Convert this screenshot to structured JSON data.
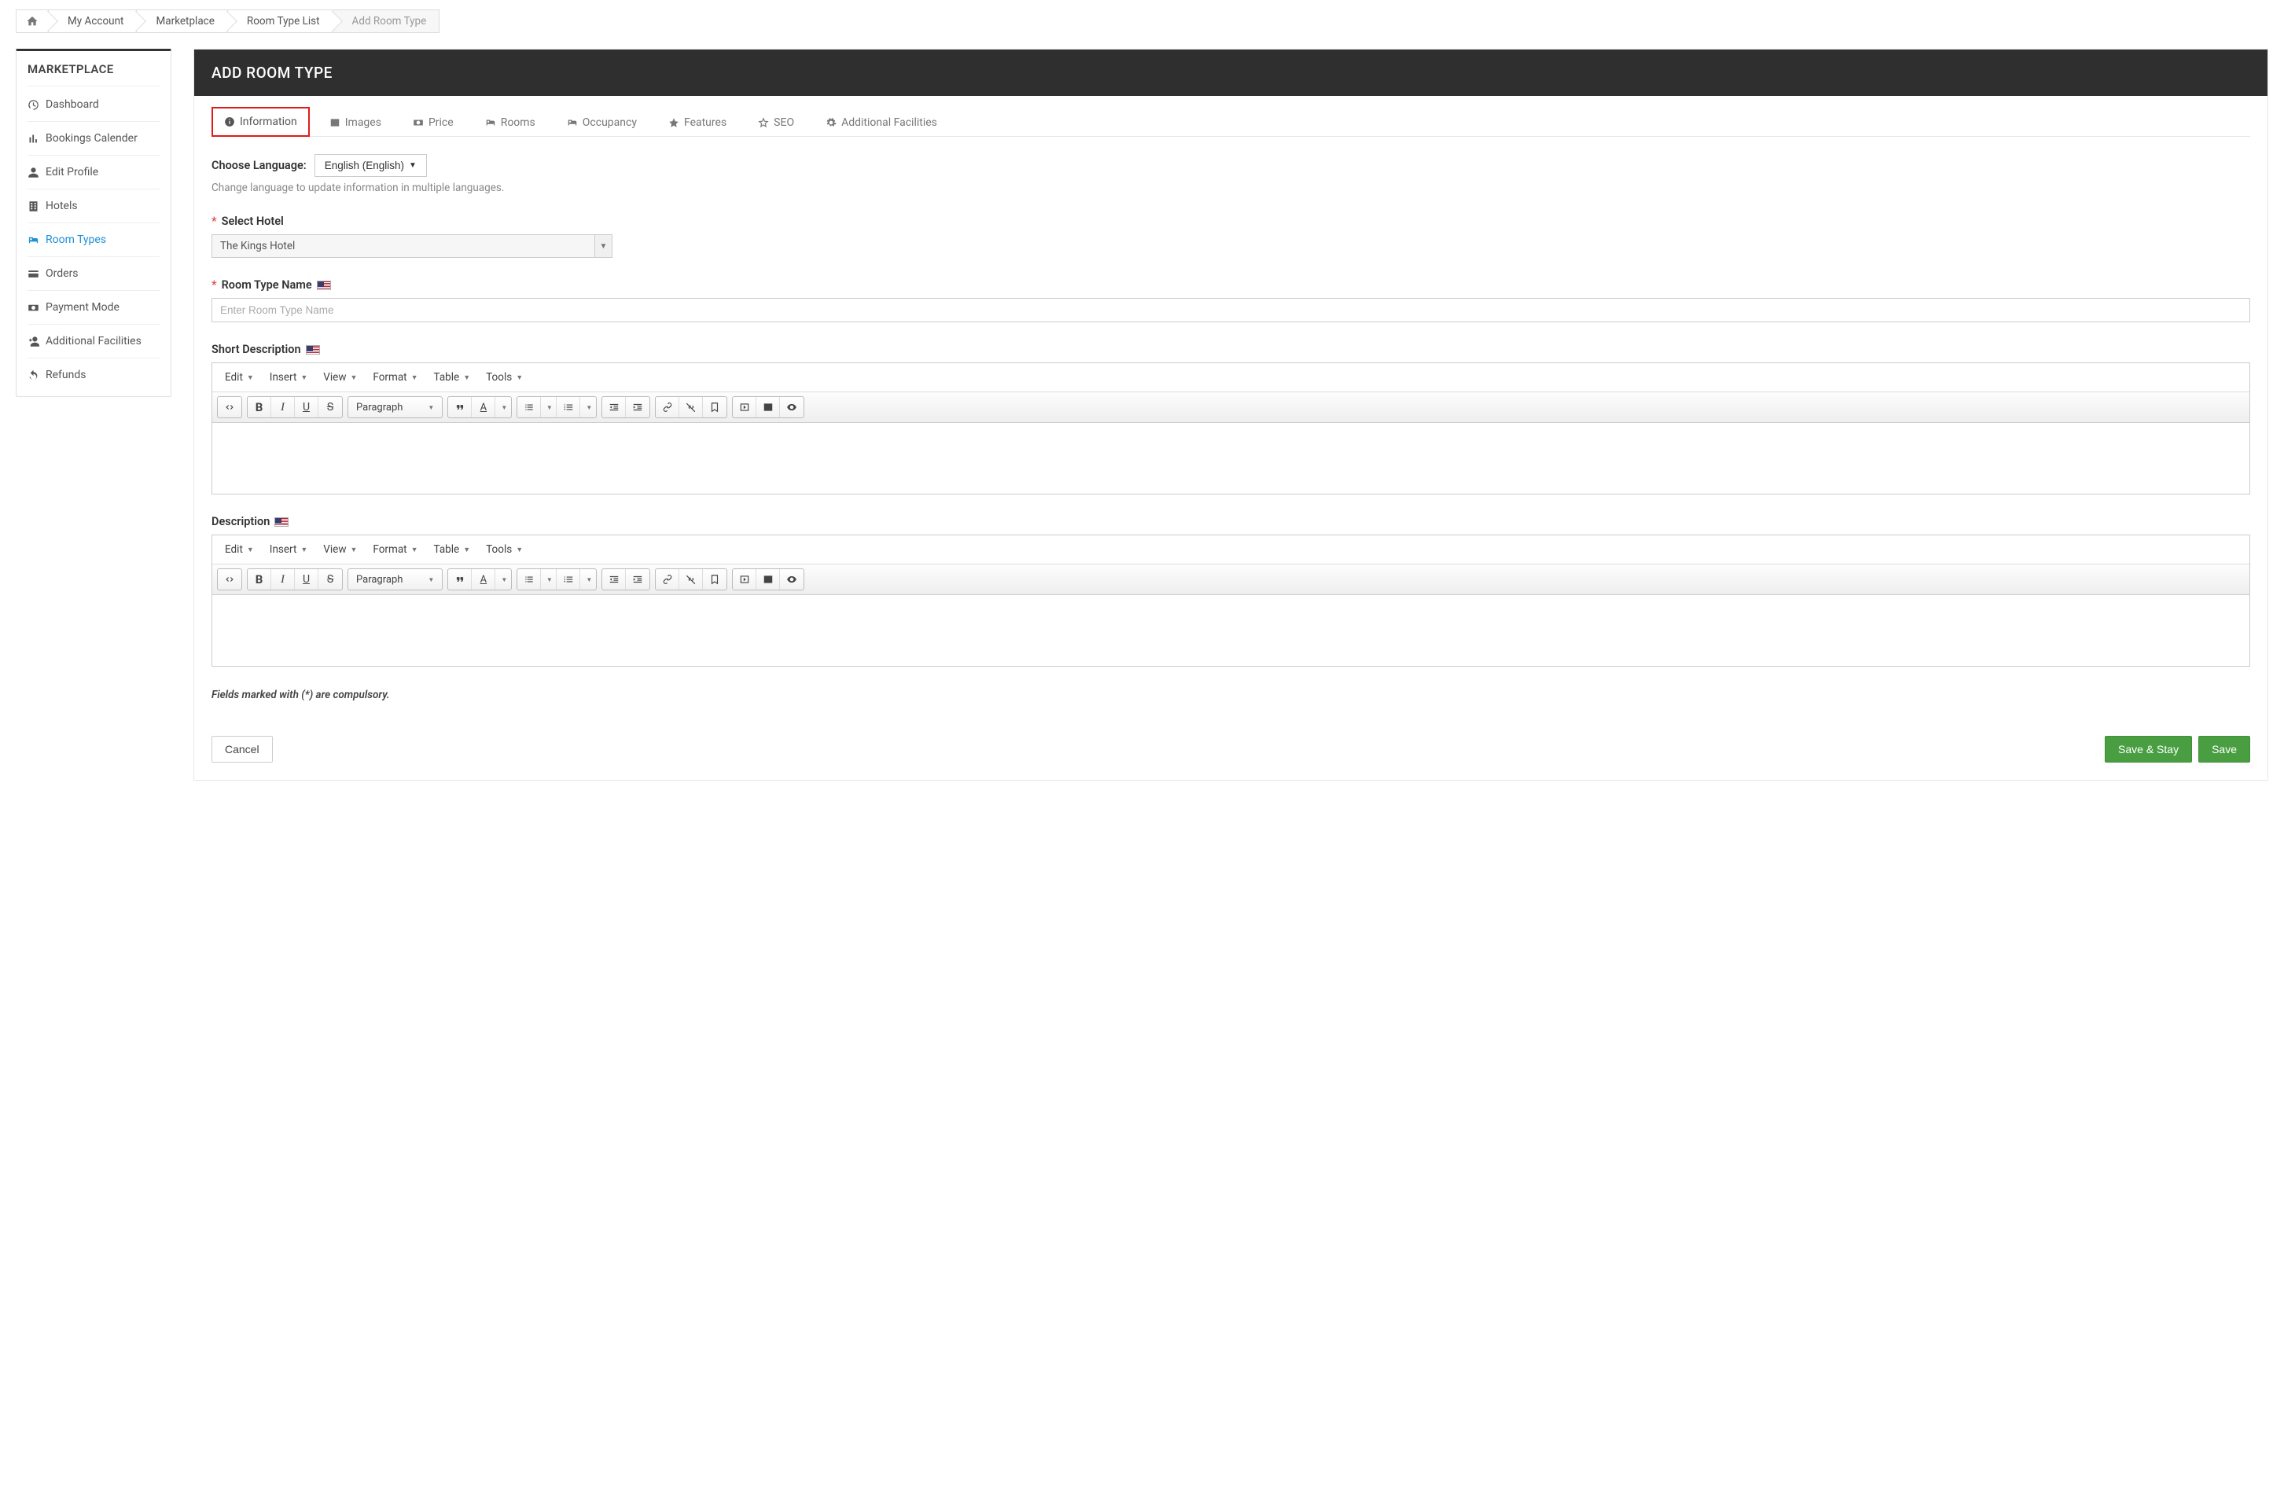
{
  "breadcrumb": {
    "items": [
      "My Account",
      "Marketplace",
      "Room Type List",
      "Add Room Type"
    ]
  },
  "sidebar": {
    "title": "MARKETPLACE",
    "items": [
      {
        "label": "Dashboard"
      },
      {
        "label": "Bookings Calender"
      },
      {
        "label": "Edit Profile"
      },
      {
        "label": "Hotels"
      },
      {
        "label": "Room Types"
      },
      {
        "label": "Orders"
      },
      {
        "label": "Payment Mode"
      },
      {
        "label": "Additional Facilities"
      },
      {
        "label": "Refunds"
      }
    ]
  },
  "header": {
    "title": "ADD ROOM TYPE"
  },
  "tabs": [
    {
      "label": "Information"
    },
    {
      "label": "Images"
    },
    {
      "label": "Price"
    },
    {
      "label": "Rooms"
    },
    {
      "label": "Occupancy"
    },
    {
      "label": "Features"
    },
    {
      "label": "SEO"
    },
    {
      "label": "Additional Facilities"
    }
  ],
  "language": {
    "label": "Choose Language:",
    "selected": "English (English)",
    "hint": "Change language to update information in multiple languages."
  },
  "fields": {
    "select_hotel": {
      "label": "Select Hotel",
      "value": "The Kings Hotel"
    },
    "room_type_name": {
      "label": "Room Type Name",
      "placeholder": "Enter Room Type Name"
    },
    "short_description": {
      "label": "Short Description"
    },
    "description": {
      "label": "Description"
    }
  },
  "rte": {
    "menubar": [
      "Edit",
      "Insert",
      "View",
      "Format",
      "Table",
      "Tools"
    ],
    "paragraph_label": "Paragraph"
  },
  "compulsory_note": "Fields marked with (*) are compulsory.",
  "buttons": {
    "cancel": "Cancel",
    "save_stay": "Save & Stay",
    "save": "Save"
  }
}
